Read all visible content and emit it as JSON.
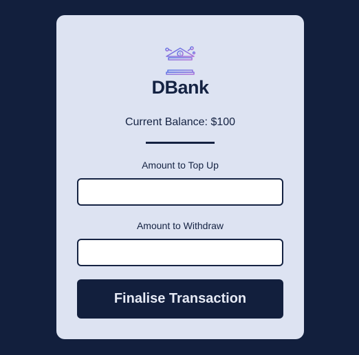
{
  "brand": {
    "name": "DBank",
    "logo_icon": "bank-building-icon"
  },
  "balance": {
    "text": "Current Balance: $100"
  },
  "topup": {
    "label": "Amount to Top Up",
    "value": "",
    "placeholder": ""
  },
  "withdraw": {
    "label": "Amount to Withdraw",
    "value": "",
    "placeholder": ""
  },
  "submit": {
    "label": "Finalise Transaction"
  },
  "colors": {
    "background": "#121f3d",
    "card": "#dde3f2",
    "text": "#142242",
    "button": "#121f3d",
    "button_text": "#e6eaf5",
    "logo_gradient_start": "#6a7ee8",
    "logo_gradient_end": "#a675d8"
  }
}
